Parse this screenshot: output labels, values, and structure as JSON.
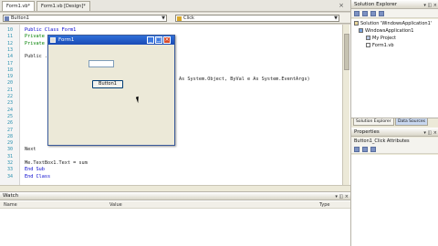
{
  "editor": {
    "tabs": [
      "Form1.vb*",
      "Form1.vb [Design]*"
    ],
    "object_combo": "Button1",
    "event_combo": "Click",
    "lines": [
      {
        "n": "10",
        "code": "Public Class Form1",
        "style": "kw"
      },
      {
        "n": "11",
        "code": "  Private ...",
        "style": "cm"
      },
      {
        "n": "12",
        "code": "  Private ...",
        "style": "cm"
      },
      {
        "n": "13",
        "code": "",
        "style": ""
      },
      {
        "n": "14",
        "code": "  Public ...",
        "style": ""
      },
      {
        "n": "17",
        "code": "",
        "style": ""
      },
      {
        "n": "18",
        "code": "",
        "style": ""
      },
      {
        "n": "19",
        "code": "",
        "style": ""
      },
      {
        "n": "20",
        "code": "",
        "style": ""
      },
      {
        "n": "21",
        "code": "",
        "style": ""
      },
      {
        "n": "22",
        "code": "",
        "style": ""
      },
      {
        "n": "23",
        "code": "",
        "style": ""
      },
      {
        "n": "24",
        "code": "",
        "style": ""
      },
      {
        "n": "25",
        "code": "",
        "style": ""
      },
      {
        "n": "26",
        "code": "",
        "style": ""
      },
      {
        "n": "27",
        "code": "",
        "style": ""
      },
      {
        "n": "28",
        "code": "",
        "style": ""
      },
      {
        "n": "29",
        "code": "",
        "style": ""
      },
      {
        "n": "30",
        "code": "        Next",
        "style": ""
      },
      {
        "n": "31",
        "code": "",
        "style": ""
      },
      {
        "n": "32",
        "code": "        Me.TextBox1.Text = sum",
        "style": ""
      },
      {
        "n": "33",
        "code": "    End Sub",
        "style": "kw"
      },
      {
        "n": "34",
        "code": "End Class",
        "style": "kw"
      }
    ],
    "handler_signature": "As System.Object, ByVal e As System.EventArgs)"
  },
  "form_window": {
    "title": "Form1",
    "minimize": "_",
    "maximize": "□",
    "close": "×",
    "button_label": "Button1"
  },
  "solution_explorer": {
    "title": "Solution Explorer",
    "items": [
      "Solution 'WindowsApplication1'",
      "WindowsApplication1",
      "My Project",
      "Form1.vb"
    ],
    "tab_active": "Solution Explorer",
    "tab_inactive": "Data Sources"
  },
  "properties": {
    "title": "Properties",
    "subject": "Button1_Click  Attributes"
  },
  "watch": {
    "title": "Watch",
    "columns": [
      "Name",
      "Value",
      "Type"
    ]
  }
}
